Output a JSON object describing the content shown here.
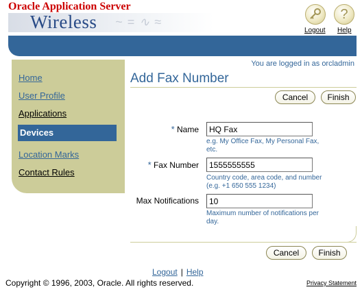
{
  "header": {
    "brand_top": "Oracle Application Server",
    "brand_product": "Wireless",
    "global_links": {
      "logout": "Logout",
      "help": "Help"
    },
    "help_icon_glyph": "?"
  },
  "sidebar": {
    "items": [
      {
        "label": "Home",
        "selected": false
      },
      {
        "label": "User Profile",
        "selected": false
      },
      {
        "label": "Applications",
        "selected": false
      },
      {
        "label": "Devices",
        "selected": true
      },
      {
        "label": "Location Marks",
        "selected": false
      },
      {
        "label": "Contact Rules",
        "selected": false
      }
    ]
  },
  "main": {
    "user_info": "You are logged in as orcladmin",
    "page_title": "Add Fax Number",
    "buttons": {
      "cancel": "Cancel",
      "finish": "Finish"
    },
    "required_marker": "*",
    "fields": {
      "name": {
        "label": "Name",
        "value": "HQ Fax",
        "hint": "e.g. My Office Fax, My Personal Fax, etc."
      },
      "fax_number": {
        "label": "Fax Number",
        "value": "1555555555",
        "hint": "Country code, area code, and number (e.g. +1 650 555 1234)"
      },
      "max_notifications": {
        "label": "Max Notifications",
        "value": "10",
        "hint": "Maximum number of notifications per day."
      }
    }
  },
  "footer": {
    "logout": "Logout",
    "separator": "|",
    "help": "Help",
    "copyright": "Copyright © 1996, 2003, Oracle. All rights reserved.",
    "privacy": "Privacy Statement"
  },
  "colors": {
    "accent_blue": "#336699",
    "khaki": "#cccc99",
    "brand_red": "#cc0000"
  }
}
